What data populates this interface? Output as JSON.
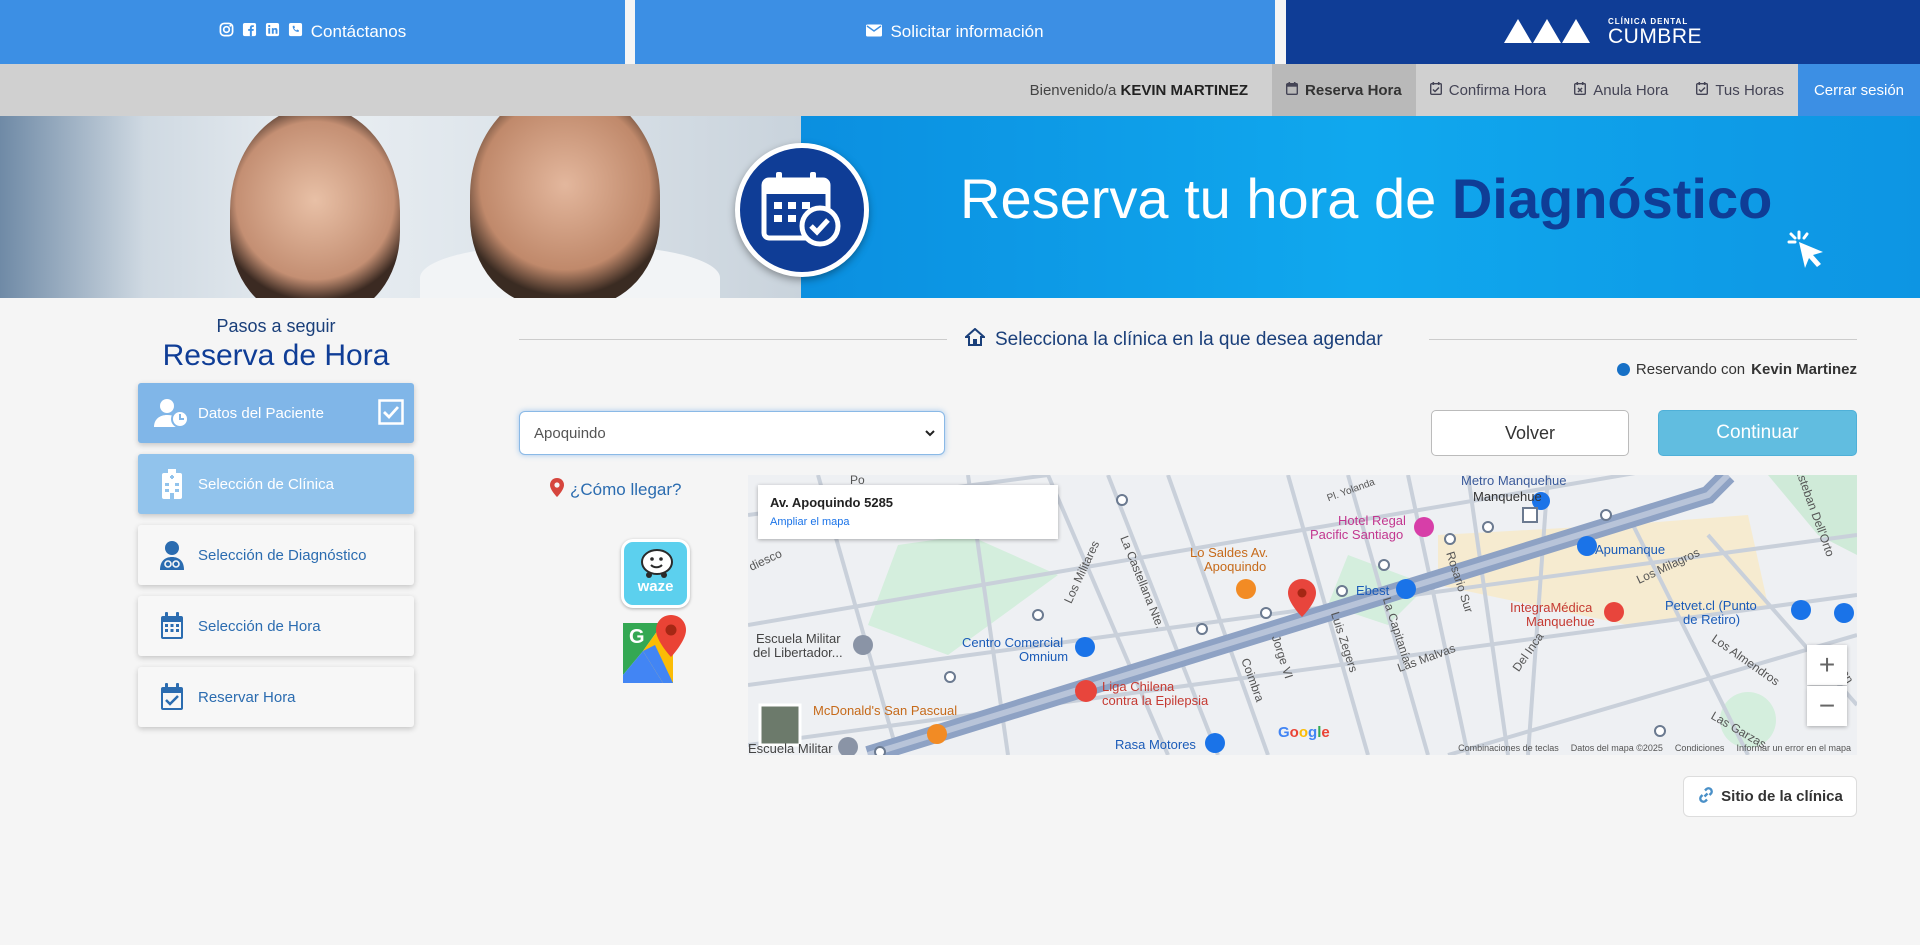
{
  "topbar": {
    "contact_label": "Contáctanos",
    "info_label": "Solicitar información",
    "logo_small": "CLÍNICA DENTAL",
    "logo_big": "CUMBRE",
    "colors": {
      "light": "#3c8fe4",
      "dark": "#0f3d96"
    }
  },
  "navbar": {
    "welcome_prefix": "Bienvenido/a",
    "user_name": "KEVIN MARTINEZ",
    "items": [
      {
        "label": "Reserva Hora",
        "icon": "calendar-icon"
      },
      {
        "label": "Confirma Hora",
        "icon": "calendar-check-icon"
      },
      {
        "label": "Anula Hora",
        "icon": "calendar-x-icon"
      },
      {
        "label": "Tus Horas",
        "icon": "calendar-check-icon"
      }
    ],
    "logout_label": "Cerrar sesión"
  },
  "banner": {
    "text_light": "Reserva tu hora de",
    "text_bold": "Diagnóstico"
  },
  "steps": {
    "subtitle": "Pasos a seguir",
    "title": "Reserva de Hora",
    "items": [
      {
        "label": "Datos del Paciente",
        "state": "done"
      },
      {
        "label": "Selección de Clínica",
        "state": "current"
      },
      {
        "label": "Selección de Diagnóstico",
        "state": "pending"
      },
      {
        "label": "Selección de Hora",
        "state": "pending"
      },
      {
        "label": "Reservar Hora",
        "state": "pending"
      }
    ]
  },
  "main": {
    "section_title": "Selecciona la clínica en la que desea agendar",
    "reserving_prefix": "Reservando con",
    "reserving_name": "Kevin Martinez",
    "clinic_select_value": "Apoquindo",
    "back_label": "Volver",
    "continue_label": "Continuar",
    "how_to_get": "¿Cómo llegar?",
    "waze_label": "waze",
    "site_label": "Sitio de la clínica"
  },
  "map": {
    "address": "Av. Apoquindo 5285",
    "enlarge": "Ampliar el mapa",
    "labels": {
      "metro": "Metro Manquehue",
      "manquehue": "Manquehue",
      "hotel1": "Hotel Regal",
      "hotel2": "Pacific Santiago",
      "saldes1": "Lo Saldes Av.",
      "saldes2": "Apoquindo",
      "apumanque": "Apumanque",
      "ebest": "Ebest",
      "integra1": "IntegraMédica",
      "integra2": "Manquehue",
      "petvet1": "Petvet.cl (Punto",
      "petvet2": "de Retiro)",
      "escuela1": "Escuela Militar",
      "escuela2": "del Libertador...",
      "centro1": "Centro Comercial",
      "centro2": "Omnium",
      "liga1": "Liga Chilena",
      "liga2": "contra la Epilepsia",
      "mcd": "McDonald's San Pascual",
      "rasa": "Rasa Motores",
      "escuela3": "Escuela Militar",
      "s_militares": "Los Militares",
      "s_castellana": "La Castellana Nte.",
      "s_jorge": "Jorge VI",
      "s_luis": "Luis Zegers",
      "s_capitania": "La Capitanía",
      "s_rosario": "Rosario Sur",
      "s_malvas": "Las Malvas",
      "s_delinca": "Del Inca",
      "s_coimbra": "Coimbra",
      "s_milagros": "Los Milagros",
      "s_almendros": "Los Almendros",
      "s_garzas": "Las Garzas",
      "s_delorto": "Esteban Dell'Orto",
      "s_yolanda": "Pl. Yolanda",
      "s_diesco": "diesco",
      "s_po": "Po",
      "s_mon": "Mon"
    },
    "google": "Google",
    "footer": [
      "Combinaciones de teclas",
      "Datos del mapa ©2025",
      "Condiciones",
      "Informar un error en el mapa"
    ]
  }
}
